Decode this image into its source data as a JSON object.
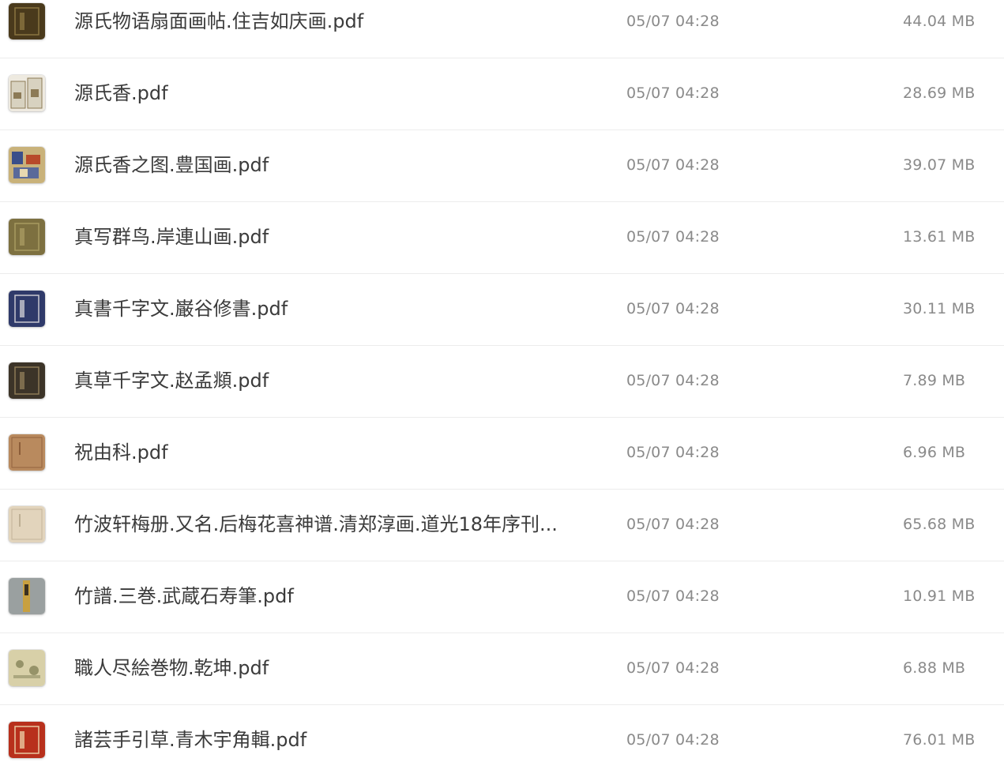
{
  "files": [
    {
      "name": "源氏物语扇面画帖.住吉如庆画.pdf",
      "date": "05/07 04:28",
      "size": "44.04 MB",
      "thumb_icon": "book-cover-icon",
      "thumb_color": "#4a3a1c",
      "thumb_accent": "#8a7440"
    },
    {
      "name": "源氏香.pdf",
      "date": "05/07 04:28",
      "size": "28.69 MB",
      "thumb_icon": "incense-boxes-icon",
      "thumb_color": "#d8d2c0",
      "thumb_accent": "#8c7a56"
    },
    {
      "name": "源氏香之图.豊国画.pdf",
      "date": "05/07 04:28",
      "size": "39.07 MB",
      "thumb_icon": "woodblock-print-icon",
      "thumb_color": "#c9b27a",
      "thumb_accent": "#3a4f8a"
    },
    {
      "name": "真写群鸟.岸連山画.pdf",
      "date": "05/07 04:28",
      "size": "13.61 MB",
      "thumb_icon": "book-cover-icon",
      "thumb_color": "#7d7040",
      "thumb_accent": "#a89a60"
    },
    {
      "name": "真書千字文.巌谷修書.pdf",
      "date": "05/07 04:28",
      "size": "30.11 MB",
      "thumb_icon": "book-cover-icon",
      "thumb_color": "#2f3a6a",
      "thumb_accent": "#c8c8d0"
    },
    {
      "name": "真草千字文.赵孟頫.pdf",
      "date": "05/07 04:28",
      "size": "7.89 MB",
      "thumb_icon": "book-cover-icon",
      "thumb_color": "#3c3428",
      "thumb_accent": "#8c7a56"
    },
    {
      "name": "祝由科.pdf",
      "date": "05/07 04:28",
      "size": "6.96 MB",
      "thumb_icon": "book-page-icon",
      "thumb_color": "#b98a5e",
      "thumb_accent": "#7a4a2a"
    },
    {
      "name": "竹波轩梅册.又名.后梅花喜神谱.清郑淳画.道光18年序刊...",
      "date": "05/07 04:28",
      "size": "65.68 MB",
      "thumb_icon": "book-page-icon",
      "thumb_color": "#e2d4bc",
      "thumb_accent": "#b0a084"
    },
    {
      "name": "竹譜.三巻.武蔵石寿筆.pdf",
      "date": "05/07 04:28",
      "size": "10.91 MB",
      "thumb_icon": "book-spine-icon",
      "thumb_color": "#9aa0a0",
      "thumb_accent": "#c8a040"
    },
    {
      "name": "職人尽絵巻物.乾坤.pdf",
      "date": "05/07 04:28",
      "size": "6.88 MB",
      "thumb_icon": "scroll-painting-icon",
      "thumb_color": "#d8d0a8",
      "thumb_accent": "#6a6a40"
    },
    {
      "name": "諸芸手引草.青木宇角輯.pdf",
      "date": "05/07 04:28",
      "size": "76.01 MB",
      "thumb_icon": "book-cover-icon",
      "thumb_color": "#b8301c",
      "thumb_accent": "#e8c8a0"
    }
  ]
}
